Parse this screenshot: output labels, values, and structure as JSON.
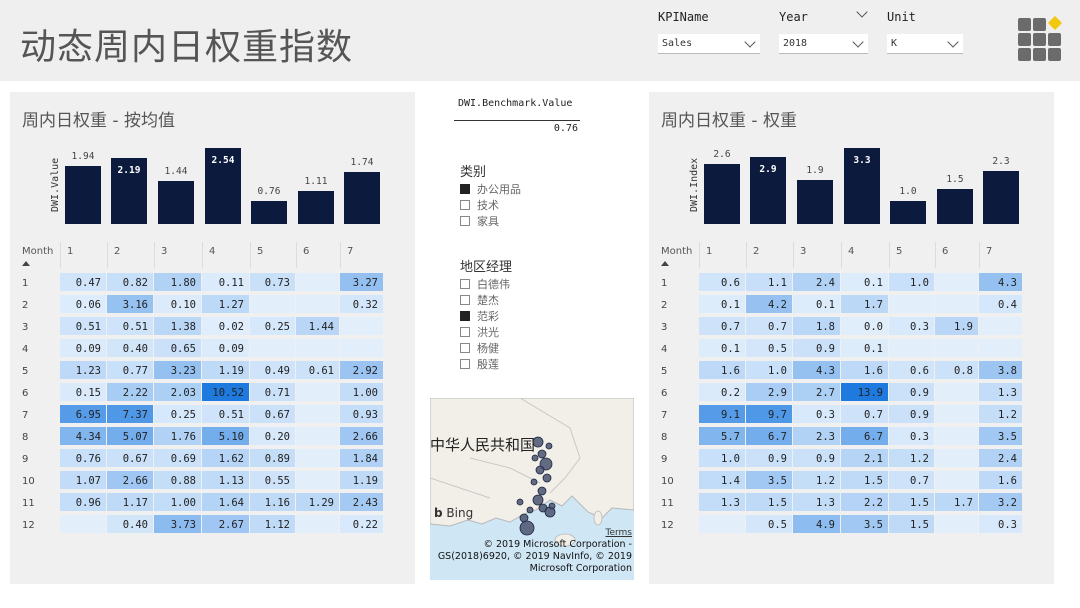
{
  "page_title": "动态周内日权重指数",
  "slicers": {
    "kpi": {
      "label": "KPIName",
      "value": "Sales"
    },
    "year": {
      "label": "Year",
      "value": "2018"
    },
    "unit": {
      "label": "Unit",
      "value": "K"
    }
  },
  "benchmark": {
    "label": "DWI.Benchmark.Value",
    "value": "0.76"
  },
  "category_filter": {
    "title": "类别",
    "items": [
      {
        "label": "办公用品",
        "checked": true
      },
      {
        "label": "技术",
        "checked": false
      },
      {
        "label": "家具",
        "checked": false
      }
    ]
  },
  "manager_filter": {
    "title": "地区经理",
    "items": [
      {
        "label": "白德伟",
        "checked": false
      },
      {
        "label": "楚杰",
        "checked": false
      },
      {
        "label": "范彩",
        "checked": true
      },
      {
        "label": "洪光",
        "checked": false
      },
      {
        "label": "杨健",
        "checked": false
      },
      {
        "label": "殷莲",
        "checked": false
      }
    ]
  },
  "map": {
    "country_label": "中华人民共和国",
    "logo": "Bing",
    "terms": "Terms",
    "attribution": "© 2019 Microsoft Corporation - GS(2018)6920, © 2019 NavInfo, © 2019 Microsoft Corporation"
  },
  "left_panel": {
    "title": "周内日权重 - 按均值",
    "matrix": {
      "corner_label": "Month",
      "columns": [
        "1",
        "2",
        "3",
        "4",
        "5",
        "6",
        "7"
      ],
      "rows": [
        {
          "label": "1",
          "values": [
            "0.47",
            "0.82",
            "1.80",
            "0.11",
            "0.73",
            "",
            "3.27"
          ]
        },
        {
          "label": "2",
          "values": [
            "0.06",
            "3.16",
            "0.10",
            "1.27",
            "",
            "",
            "0.32"
          ]
        },
        {
          "label": "3",
          "values": [
            "0.51",
            "0.51",
            "1.38",
            "0.02",
            "0.25",
            "1.44",
            ""
          ]
        },
        {
          "label": "4",
          "values": [
            "0.09",
            "0.40",
            "0.65",
            "0.09",
            "",
            "",
            ""
          ]
        },
        {
          "label": "5",
          "values": [
            "1.23",
            "0.77",
            "3.23",
            "1.19",
            "0.49",
            "0.61",
            "2.92"
          ]
        },
        {
          "label": "6",
          "values": [
            "0.15",
            "2.22",
            "2.03",
            "10.52",
            "0.71",
            "",
            "1.00"
          ]
        },
        {
          "label": "7",
          "values": [
            "6.95",
            "7.37",
            "0.25",
            "0.51",
            "0.67",
            "",
            "0.93"
          ]
        },
        {
          "label": "8",
          "values": [
            "4.34",
            "5.07",
            "1.76",
            "5.10",
            "0.20",
            "",
            "2.66"
          ]
        },
        {
          "label": "9",
          "values": [
            "0.76",
            "0.67",
            "0.69",
            "1.62",
            "0.89",
            "",
            "1.84"
          ]
        },
        {
          "label": "10",
          "values": [
            "1.07",
            "2.66",
            "0.88",
            "1.13",
            "0.55",
            "",
            "1.19"
          ]
        },
        {
          "label": "11",
          "values": [
            "0.96",
            "1.17",
            "1.00",
            "1.64",
            "1.16",
            "1.29",
            "2.43"
          ]
        },
        {
          "label": "12",
          "values": [
            "",
            "0.40",
            "3.73",
            "2.67",
            "1.12",
            "",
            "0.22"
          ]
        }
      ]
    }
  },
  "right_panel": {
    "title": "周内日权重 - 权重",
    "matrix": {
      "corner_label": "Month",
      "columns": [
        "1",
        "2",
        "3",
        "4",
        "5",
        "6",
        "7"
      ],
      "rows": [
        {
          "label": "1",
          "values": [
            "0.6",
            "1.1",
            "2.4",
            "0.1",
            "1.0",
            "",
            "4.3"
          ]
        },
        {
          "label": "2",
          "values": [
            "0.1",
            "4.2",
            "0.1",
            "1.7",
            "",
            "",
            "0.4"
          ]
        },
        {
          "label": "3",
          "values": [
            "0.7",
            "0.7",
            "1.8",
            "0.0",
            "0.3",
            "1.9",
            ""
          ]
        },
        {
          "label": "4",
          "values": [
            "0.1",
            "0.5",
            "0.9",
            "0.1",
            "",
            "",
            ""
          ]
        },
        {
          "label": "5",
          "values": [
            "1.6",
            "1.0",
            "4.3",
            "1.6",
            "0.6",
            "0.8",
            "3.8"
          ]
        },
        {
          "label": "6",
          "values": [
            "0.2",
            "2.9",
            "2.7",
            "13.9",
            "0.9",
            "",
            "1.3"
          ]
        },
        {
          "label": "7",
          "values": [
            "9.1",
            "9.7",
            "0.3",
            "0.7",
            "0.9",
            "",
            "1.2"
          ]
        },
        {
          "label": "8",
          "values": [
            "5.7",
            "6.7",
            "2.3",
            "6.7",
            "0.3",
            "",
            "3.5"
          ]
        },
        {
          "label": "9",
          "values": [
            "1.0",
            "0.9",
            "0.9",
            "2.1",
            "1.2",
            "",
            "2.4"
          ]
        },
        {
          "label": "10",
          "values": [
            "1.4",
            "3.5",
            "1.2",
            "1.5",
            "0.7",
            "",
            "1.6"
          ]
        },
        {
          "label": "11",
          "values": [
            "1.3",
            "1.5",
            "1.3",
            "2.2",
            "1.5",
            "1.7",
            "3.2"
          ]
        },
        {
          "label": "12",
          "values": [
            "",
            "0.5",
            "4.9",
            "3.5",
            "1.5",
            "",
            "0.3"
          ]
        }
      ]
    }
  },
  "colors": {
    "bar": "#0b1a3d",
    "accent": "#1f7ae0",
    "panel_bg": "#f0f0f0"
  },
  "chart_data": [
    {
      "type": "bar",
      "title": "",
      "ylabel": "DWI.Value",
      "categories": [
        "1",
        "2",
        "3",
        "4",
        "5",
        "6",
        "7"
      ],
      "values": [
        1.94,
        2.19,
        1.44,
        2.54,
        0.76,
        1.11,
        1.74
      ],
      "value_labels": [
        "1.94",
        "2.19",
        "1.44",
        "2.54",
        "0.76",
        "1.11",
        "1.74"
      ],
      "highlighted": [
        1,
        3
      ],
      "ylim": [
        0,
        2.54
      ]
    },
    {
      "type": "bar",
      "title": "",
      "ylabel": "DWI.Index",
      "categories": [
        "1",
        "2",
        "3",
        "4",
        "5",
        "6",
        "7"
      ],
      "values": [
        2.6,
        2.9,
        1.9,
        3.3,
        1.0,
        1.5,
        2.3
      ],
      "value_labels": [
        "2.6",
        "2.9",
        "1.9",
        "3.3",
        "1.0",
        "1.5",
        "2.3"
      ],
      "highlighted": [
        1,
        3
      ],
      "ylim": [
        0,
        3.3
      ]
    }
  ]
}
